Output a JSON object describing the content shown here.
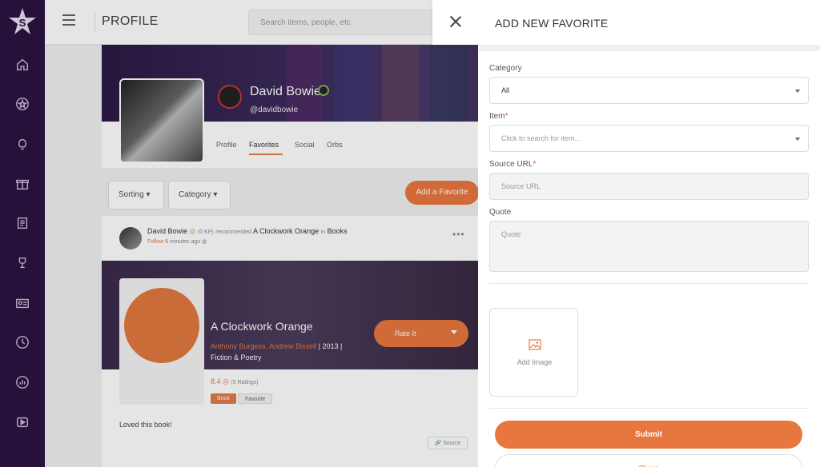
{
  "app": {
    "logo_icon": "star-logo-icon",
    "brand_color": "#e8773f",
    "sidebar_color": "#2a1340"
  },
  "sidebar": {
    "items": [
      {
        "icon": "home-icon"
      },
      {
        "icon": "star-icon"
      },
      {
        "icon": "lightbulb-icon"
      },
      {
        "icon": "gift-icon"
      },
      {
        "icon": "document-icon"
      },
      {
        "icon": "trophy-icon"
      },
      {
        "icon": "id-card-icon"
      },
      {
        "icon": "clock-icon"
      },
      {
        "icon": "chart-icon"
      },
      {
        "icon": "video-icon"
      }
    ]
  },
  "header": {
    "title": "PROFILE",
    "search_placeholder": "Search items, people, etc"
  },
  "profile": {
    "name": "David Bowie",
    "handle": "@davidbowie",
    "tabs": [
      "Profile",
      "Favorites",
      "Social",
      "Orbs"
    ],
    "active_tab": "Favorites"
  },
  "toolbar": {
    "sorting_label": "Sorting",
    "category_label": "Category",
    "add_favorite_label": "Add a Favorite"
  },
  "feed": {
    "user": "David Bowie",
    "kp": "(0 KP)",
    "action": "recommended",
    "item": "A Clockwork Orange",
    "in_word": "in",
    "category": "Books",
    "follow": "Follow",
    "time": "6 minutes ago",
    "more": "•••",
    "book_title": "A Clockwork Orange",
    "author1": "Anthony Burgess",
    "author2": "Andrew Bissell",
    "year_suffix": "| 2013 |",
    "genre": "Fiction & Poetry",
    "rate_label": "Rate It",
    "rating": "8.4",
    "ratings_count": "(5 Ratings)",
    "tags": [
      "Book",
      "Favorite"
    ],
    "comment": "Loved this book!",
    "source_label": "Source"
  },
  "drawer": {
    "title": "ADD NEW FAVORITE",
    "category_label": "Category",
    "category_value": "All",
    "item_label": "Item",
    "item_placeholder": "Click to search for item...",
    "source_label": "Source URL",
    "source_placeholder": "Source URL",
    "quote_label": "Quote",
    "quote_placeholder": "Quote",
    "add_image_label": "Add Image",
    "submit_label": "Submit",
    "close_label": "Close",
    "required_mark": "*"
  }
}
